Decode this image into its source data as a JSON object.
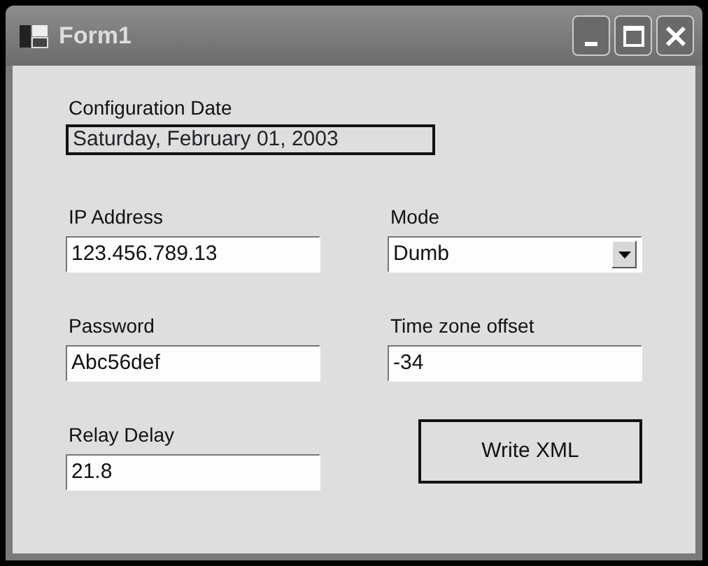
{
  "window": {
    "title": "Form1"
  },
  "config_date": {
    "label": "Configuration  Date",
    "value": "Saturday, February 01, 2003"
  },
  "fields": [
    {
      "kind": "text",
      "label": "IP Address",
      "value": "123.456.789.13"
    },
    {
      "kind": "combo",
      "label": "Mode",
      "value": "Dumb"
    },
    {
      "kind": "text",
      "label": "Password",
      "value": "Abc56def"
    },
    {
      "kind": "text",
      "label": "Time zone offset",
      "value": "-34"
    },
    {
      "kind": "text",
      "label": "Relay Delay",
      "value": "21.8"
    }
  ],
  "button": {
    "label": "Write XML"
  }
}
